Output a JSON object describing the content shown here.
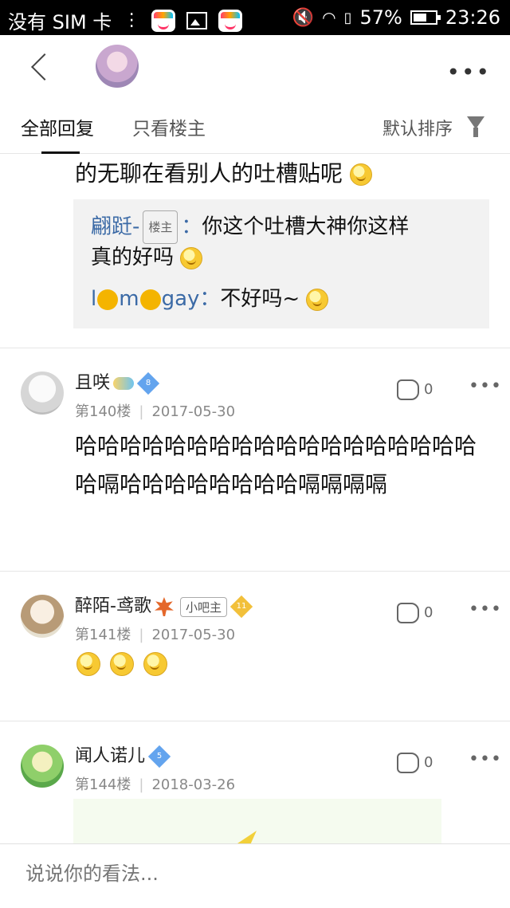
{
  "status_bar": {
    "carrier": "没有 SIM 卡",
    "battery": "57%",
    "time": "23:26"
  },
  "tabs": {
    "all_replies": "全部回复",
    "op_only": "只看楼主",
    "sort": "默认排序"
  },
  "thread": {
    "top_text": "的无聊在看别人的吐槽贴呢",
    "replies": [
      {
        "author": "翩跹-",
        "badge": "楼主",
        "separator": "：",
        "text_line1": "你这个吐槽大神你这样",
        "text_line2": "真的好吗"
      },
      {
        "author_prefix": "l",
        "author_mid": "m",
        "author_suffix": "gay",
        "separator": "：",
        "text": "不好吗~"
      }
    ]
  },
  "posts": [
    {
      "username": "且咲",
      "level": "8",
      "floor": "第140楼",
      "date": "2017-05-30",
      "likes": "0",
      "text": "哈哈哈哈哈哈哈哈哈哈哈哈哈哈哈哈哈哈哈嗝哈哈哈哈哈哈哈哈嗝嗝嗝嗝"
    },
    {
      "username": "醉陌-鸢歌",
      "role": "小吧主",
      "level": "11",
      "floor": "第141楼",
      "date": "2017-05-30",
      "likes": "0"
    },
    {
      "username": "闻人诺儿",
      "level": "5",
      "floor": "第144楼",
      "date": "2018-03-26",
      "likes": "0"
    }
  ],
  "bottom": {
    "placeholder": "说说你的看法..."
  },
  "colors": {
    "link_blue": "#3b6aa6",
    "level_blue": "#63a4ee",
    "level_gold": "#f2c03a"
  }
}
